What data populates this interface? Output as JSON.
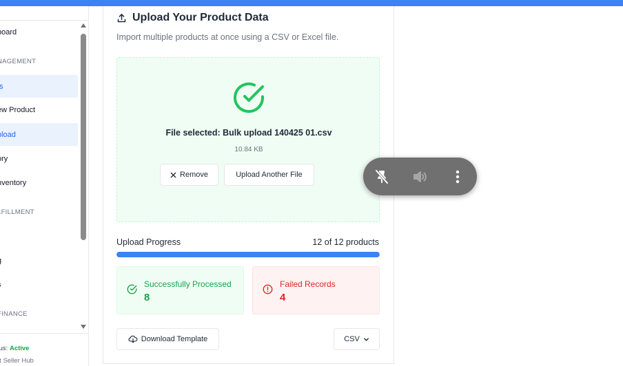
{
  "colors": {
    "accent": "#3b82f6",
    "success": "#16a34a",
    "error": "#dc2626",
    "sidebar_active_bg": "#eaf2fe"
  },
  "sidebar": {
    "items": [
      {
        "label": "board",
        "active": false
      },
      {
        "label": "ts",
        "active": true
      },
      {
        "label": "ew Product",
        "active": false
      },
      {
        "label": "pload",
        "active": true
      },
      {
        "label": "ory",
        "active": false
      },
      {
        "label": "nventory",
        "active": false
      },
      {
        "label": "g",
        "active": false
      },
      {
        "label": "s",
        "active": false
      }
    ],
    "sections": [
      "NAGEMENT",
      "LFILLMENT",
      "FINANCE"
    ],
    "status_prefix": "tus: ",
    "status_value": "Active",
    "hub_label": "rt Seller Hub"
  },
  "main": {
    "title": "Upload Your Product Data",
    "subtitle": "Import multiple products at once using a CSV or Excel file.",
    "dropzone": {
      "file_selected": "File selected: Bulk upload 140425 01.csv",
      "file_size": "10.84 KB",
      "remove_label": "Remove",
      "upload_another_label": "Upload Another File"
    },
    "progress": {
      "label": "Upload Progress",
      "count_text": "12 of 12 products",
      "fraction": 1.0
    },
    "stats": {
      "success_label": "Successfully Processed",
      "success_value": "8",
      "failed_label": "Failed Records",
      "failed_value": "4"
    },
    "download_template_label": "Download Template",
    "format_select_value": "CSV"
  },
  "overlay": {
    "icons": [
      "unpin-icon",
      "volume-icon",
      "more-vertical-icon"
    ]
  }
}
